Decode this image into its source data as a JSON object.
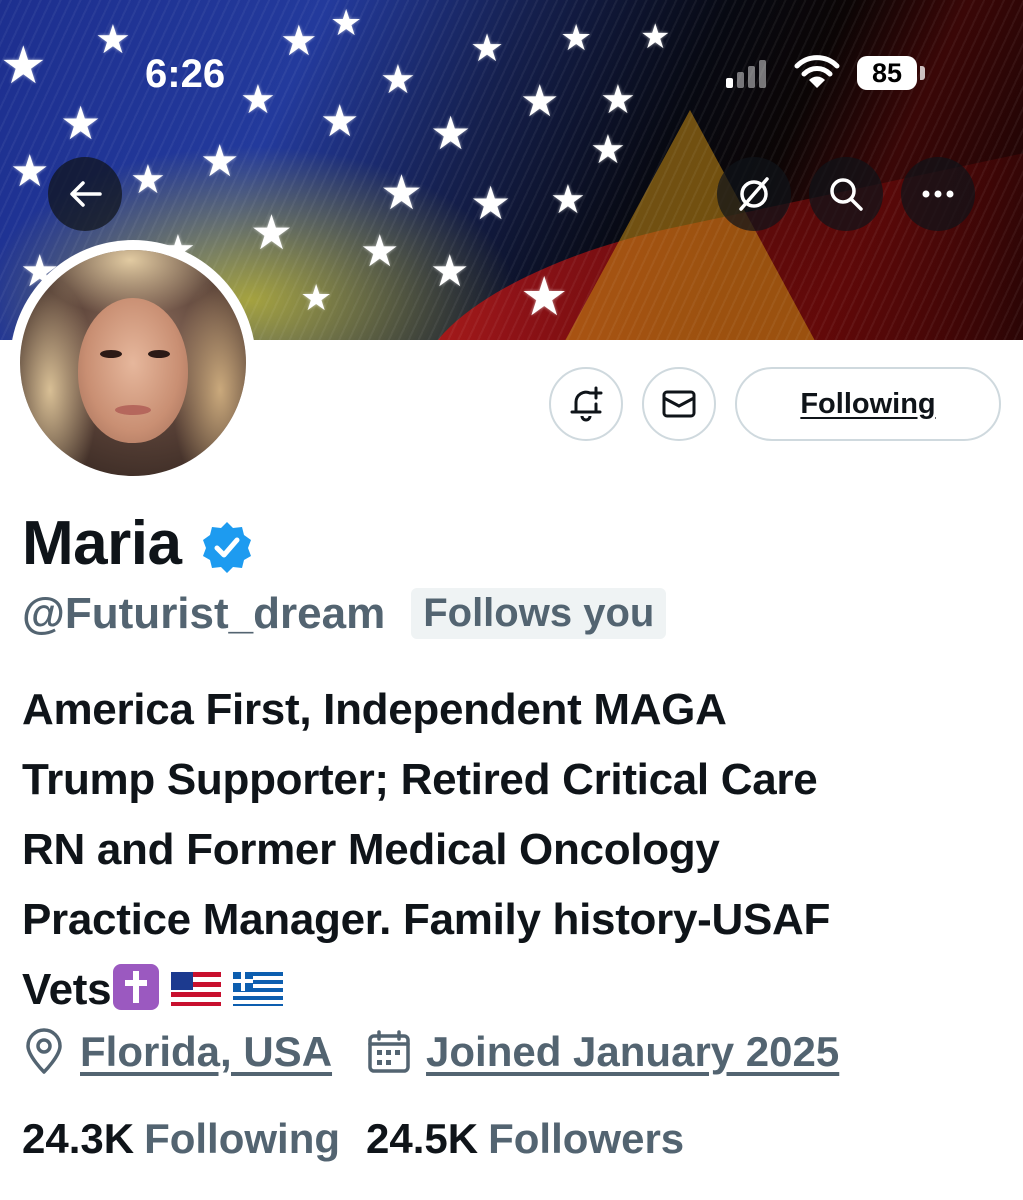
{
  "status_bar": {
    "time": "6:26",
    "battery": "85",
    "signal_bars": 1,
    "icons": [
      "signal-icon",
      "wifi-icon",
      "battery-icon"
    ]
  },
  "banner_controls": {
    "icons": [
      "back-arrow-icon",
      "grok-icon",
      "search-icon",
      "more-icon"
    ]
  },
  "actions": {
    "icons": [
      "notification-bell-plus-icon",
      "mail-icon"
    ],
    "following_label": "Following"
  },
  "profile": {
    "name": "Maria",
    "verified": true,
    "verified_color": "#1d9bf0",
    "handle": "@Futurist_dream",
    "follows_you": "Follows you",
    "bio_lines": [
      "America First, Independent MAGA",
      "Trump Supporter; Retired Critical Care",
      "RN and Former Medical Oncology",
      "Practice Manager. Family history-USAF",
      "Vets"
    ],
    "bio_emojis": [
      "latin-cross-emoji",
      "us-flag-emoji",
      "greece-flag-emoji"
    ],
    "location": "Florida, USA",
    "joined": "Joined January 2025",
    "following_count": "24.3K",
    "following_label": "Following",
    "followers_count": "24.5K",
    "followers_label": "Followers"
  },
  "colors": {
    "text_primary": "#0f1419",
    "text_secondary": "#536471",
    "border": "#cfd9de",
    "badge_bg": "#eff3f4"
  }
}
